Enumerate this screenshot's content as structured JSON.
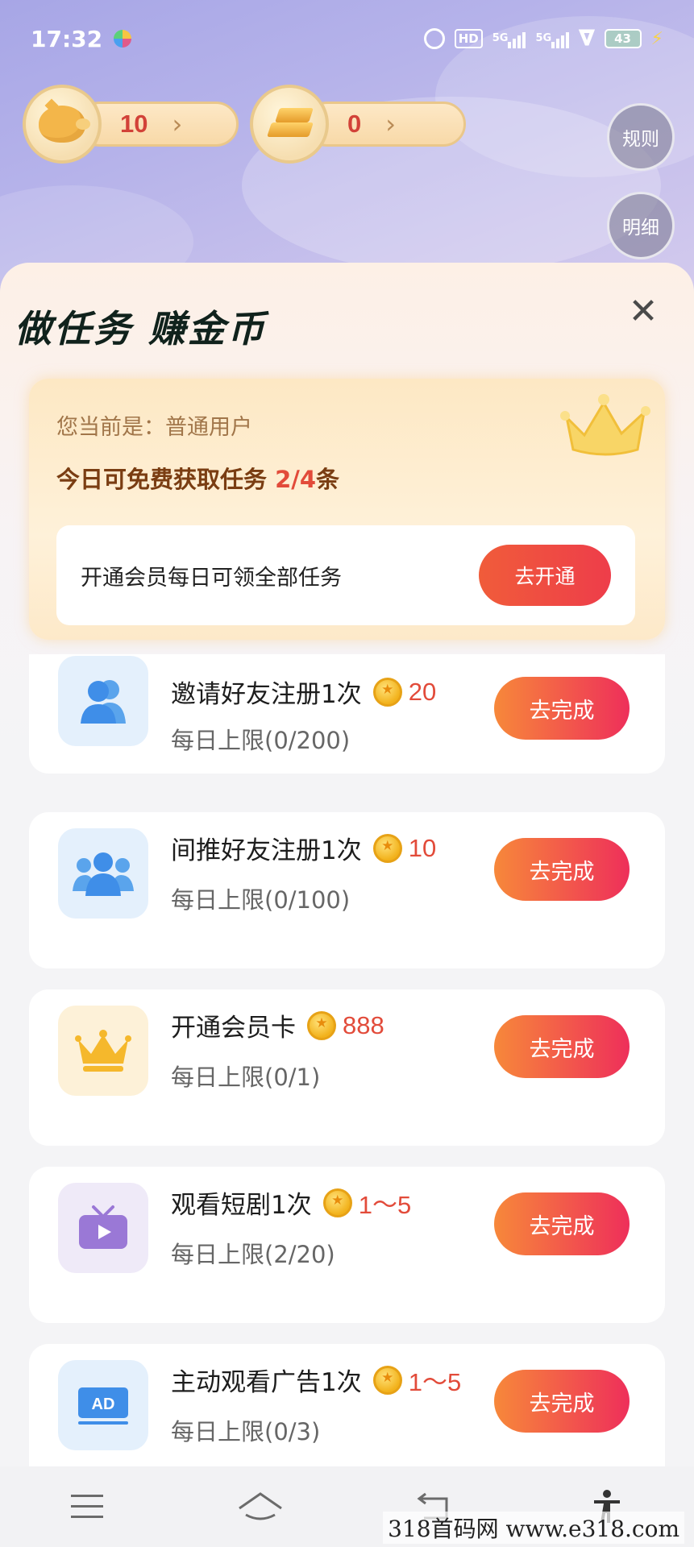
{
  "status_bar": {
    "time": "17:32",
    "hd": "HD",
    "net1": "5G",
    "net2": "5G",
    "battery": "43"
  },
  "balances": [
    {
      "name": "piggy-bank",
      "value": "10"
    },
    {
      "name": "gold-bar",
      "value": "0"
    }
  ],
  "side_buttons": {
    "rules": "规则",
    "details": "明细"
  },
  "sheet": {
    "title": "做任务  赚金币",
    "member": {
      "current_label": "您当前是：",
      "current_value": "普通用户",
      "free_prefix": "今日可免费获取任务 ",
      "free_count": "2/4",
      "free_suffix": "条",
      "promo_text": "开通会员每日可领全部任务",
      "open_button": "去开通"
    },
    "tasks": [
      {
        "title": "邀请好友注册1次",
        "reward": "20",
        "limit": "每日上限(0/200)",
        "button": "去完成",
        "icon": "users-icon"
      },
      {
        "title": "间推好友注册1次",
        "reward": "10",
        "limit": "每日上限(0/100)",
        "button": "去完成",
        "icon": "group-icon"
      },
      {
        "title": "开通会员卡",
        "reward": "888",
        "limit": "每日上限(0/1)",
        "button": "去完成",
        "icon": "crown-icon"
      },
      {
        "title": "观看短剧1次",
        "reward": "1～5",
        "limit": "每日上限(2/20)",
        "button": "去完成",
        "icon": "tv-icon"
      },
      {
        "title": "主动观看广告1次",
        "reward": "1～5",
        "limit": "每日上限(0/3)",
        "button": "去完成",
        "icon": "ad-icon"
      }
    ]
  },
  "watermark": "318首码网 www.e318.com",
  "colors": {
    "accent_red": "#e24b3a",
    "button_gradient_start": "#f7883a",
    "button_gradient_end": "#ee2f5a"
  }
}
